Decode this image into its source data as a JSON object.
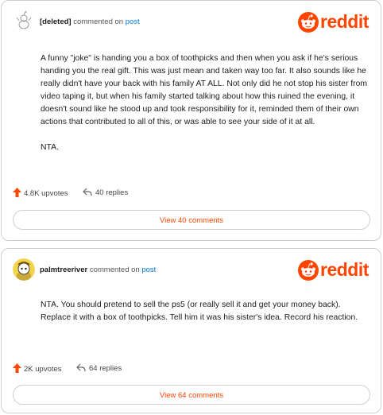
{
  "brand": {
    "wordmark": "reddit",
    "color": "#ff4500"
  },
  "comments": [
    {
      "username": "[deleted]",
      "action_text": "commented on",
      "post_link": "post",
      "avatar": "deleted-user-icon",
      "paragraphs": [
        "A funny \"joke\" is handing you a box of toothpicks and then when you ask if he's serious handing you the real gift. This was just mean and taken way too far. It also sounds like he really didn't have your back with his family AT ALL. Not only did he not stop his sister from video taping it, but when his family started talking about how this ruined the evening, it doesn't sound like he stood up and took responsibility for it, reminded them of their own actions that contributed to all of this, or was able to see your side of it at all.",
        "NTA."
      ],
      "upvotes": "4.8K upvotes",
      "replies": "40 replies",
      "view_button": "View 40 comments"
    },
    {
      "username": "palmtreeriver",
      "action_text": "commented on",
      "post_link": "post",
      "avatar": "snoo-avatar-icon",
      "paragraphs": [
        "NTA. You should pretend to sell the ps5 (or really sell it and get your money back). Replace it with a box of toothpicks. Tell him it was his sister's idea. Record his reaction."
      ],
      "upvotes": "2K upvotes",
      "replies": "64 replies",
      "view_button": "View 64 comments"
    }
  ]
}
